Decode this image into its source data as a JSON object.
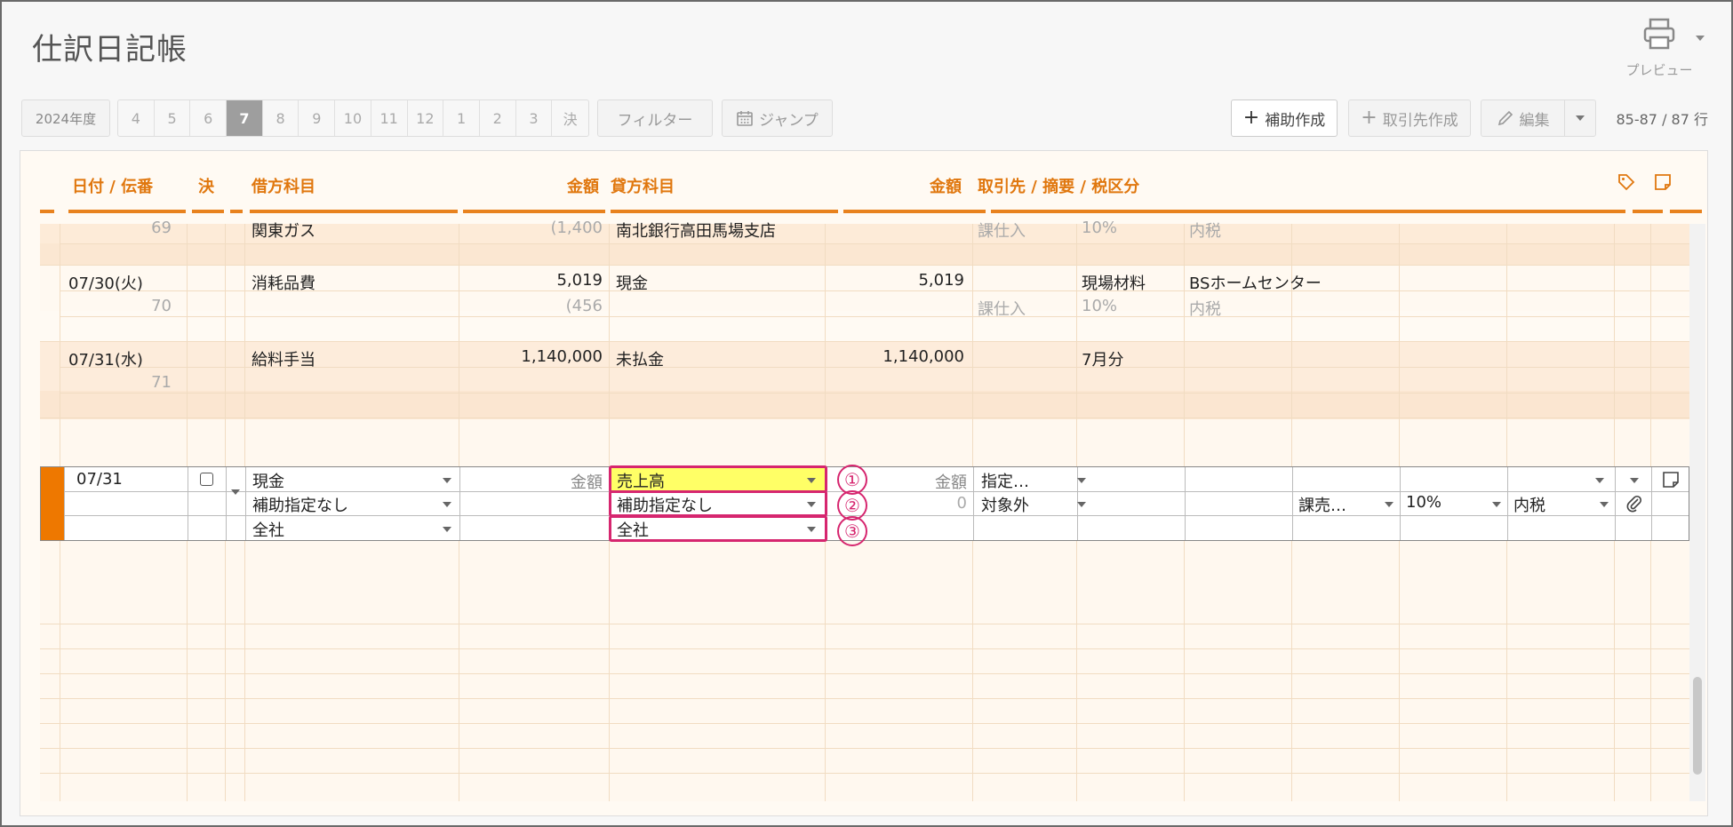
{
  "page": {
    "title": "仕訳日記帳"
  },
  "preview": {
    "label": "プレビュー",
    "icon": "printer-icon"
  },
  "toolbar": {
    "fiscal_year": "2024年度",
    "months": [
      "4",
      "5",
      "6",
      "7",
      "8",
      "9",
      "10",
      "11",
      "12",
      "1",
      "2",
      "3",
      "決"
    ],
    "active_month": "7",
    "filter_label": "フィルター",
    "jump_label": "ジャンプ",
    "aux_create_label": "補助作成",
    "partner_create_label": "取引先作成",
    "edit_label": "編集",
    "row_count": "85-87 / 87 行"
  },
  "columns": {
    "date": "日付 / 伝番",
    "settle": "決",
    "debit_account": "借方科目",
    "debit_amount": "金額",
    "credit_account": "貸方科目",
    "credit_amount": "金額",
    "partner_summary_tax": "取引先 / 摘要 / 税区分"
  },
  "rows": [
    {
      "slip_no": "69",
      "debit_account": "関東ガス",
      "debit_tax": "(1,400",
      "credit_account": "南北銀行高田馬場支店",
      "tax_category": "課仕入",
      "tax_rate": "10%",
      "tax_mode": "内税"
    },
    {
      "date": "07/30(火)",
      "slip_no": "70",
      "debit_account": "消耗品費",
      "debit_amount": "5,019",
      "debit_tax": "(456",
      "credit_account": "現金",
      "credit_amount": "5,019",
      "summary": "現場材料",
      "partner": "BSホームセンター",
      "tax_category": "課仕入",
      "tax_rate": "10%",
      "tax_mode": "内税"
    },
    {
      "date": "07/31(水)",
      "slip_no": "71",
      "debit_account": "給料手当",
      "debit_amount": "1,140,000",
      "credit_account": "未払金",
      "credit_amount": "1,140,000",
      "summary": "7月分"
    }
  ],
  "edit_row": {
    "date": "07/31",
    "debit_account": "現金",
    "debit_sub": "補助指定なし",
    "debit_dept": "全社",
    "debit_amount_placeholder": "金額",
    "credit_account": "売上高",
    "credit_sub": "補助指定なし",
    "credit_dept": "全社",
    "credit_amount_placeholder": "金額",
    "credit_tax_amount": "0",
    "partner": "指定…",
    "tax_target": "対象外",
    "tax_category": "課売…",
    "tax_rate": "10%",
    "tax_mode": "内税"
  },
  "annotations": [
    "①",
    "②",
    "③"
  ],
  "colors": {
    "accent": "#e8821e",
    "highlight": "#ffff66",
    "callout": "#d6266f",
    "active_month": "#9e9e9e"
  }
}
